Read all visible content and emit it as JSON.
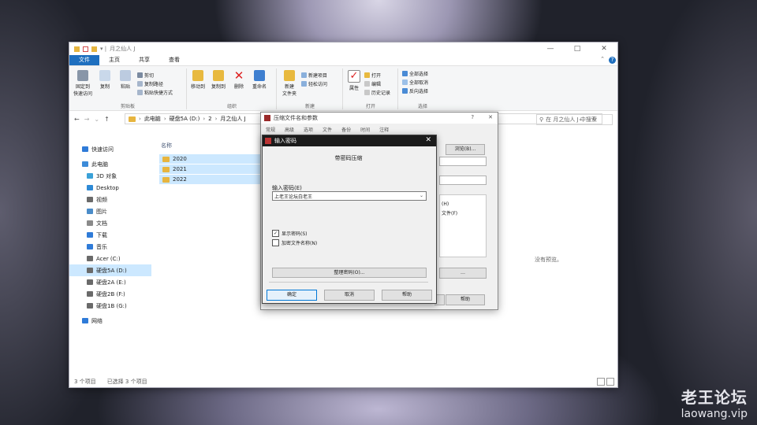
{
  "explorer": {
    "title": "月之仙人 J",
    "window_controls": [
      "—",
      "□",
      "✕"
    ],
    "tabs": [
      "文件",
      "主页",
      "共享",
      "查看"
    ],
    "ribbon": {
      "pin_label": "固定到\n快速访问",
      "copy_label": "复制",
      "paste_label": "粘贴",
      "cut_label": "剪切",
      "copy_path_label": "复制路径",
      "paste_shortcut_label": "粘贴快捷方式",
      "clipboard_group": "剪贴板",
      "move_to_label": "移动到",
      "copy_to_label": "复制到",
      "delete_label": "删除",
      "rename_label": "重命名",
      "organize_group": "组织",
      "new_folder_label": "新建\n文件夹",
      "new_item_label": "新建项目",
      "easy_access_label": "轻松访问",
      "new_group": "新建",
      "properties_label": "属性",
      "open_label": "打开",
      "edit_label": "编辑",
      "history_label": "历史记录",
      "open_group": "打开",
      "select_all_label": "全部选择",
      "select_none_label": "全部取消",
      "invert_selection_label": "反向选择",
      "select_group": "选择"
    },
    "address": {
      "crumbs": [
        "此电脑",
        "硬盘5A (D:)",
        "2",
        "月之仙人 J"
      ],
      "search_placeholder": "在 月之仙人 J 中搜索"
    },
    "nav": [
      {
        "label": "快速访问",
        "icon": "star-icon",
        "color": "#2f7bd8"
      },
      {
        "label": "此电脑",
        "icon": "computer-icon",
        "color": "#3c8bd9"
      },
      {
        "label": "3D 对象",
        "icon": "cube-icon",
        "color": "#3aa1d8"
      },
      {
        "label": "Desktop",
        "icon": "desktop-icon",
        "color": "#2e8ad6"
      },
      {
        "label": "视频",
        "icon": "video-icon",
        "color": "#6a6a6a"
      },
      {
        "label": "图片",
        "icon": "picture-icon",
        "color": "#4a8cc9"
      },
      {
        "label": "文档",
        "icon": "document-icon",
        "color": "#8a8a8a"
      },
      {
        "label": "下载",
        "icon": "download-icon",
        "color": "#2f7bd8"
      },
      {
        "label": "音乐",
        "icon": "music-icon",
        "color": "#2f7bd8"
      },
      {
        "label": "Acer (C:)",
        "icon": "drive-icon",
        "color": "#6a6a6a"
      },
      {
        "label": "硬盘5A (D:)",
        "icon": "drive-icon",
        "color": "#6a6a6a"
      },
      {
        "label": "硬盘2A (E:)",
        "icon": "drive-icon",
        "color": "#6a6a6a"
      },
      {
        "label": "硬盘2B (F:)",
        "icon": "drive-icon",
        "color": "#6a6a6a"
      },
      {
        "label": "硬盘1B (G:)",
        "icon": "drive-icon",
        "color": "#6a6a6a"
      },
      {
        "label": "网络",
        "icon": "network-icon",
        "color": "#2f7bd8"
      }
    ],
    "column_name": "名称",
    "files": [
      "2020",
      "2021",
      "2022"
    ],
    "empty_preview": "没有预览。",
    "status": {
      "count": "3 个项目",
      "selected": "已选择 3 个项目"
    }
  },
  "archive_dialog": {
    "title": "压缩文件名和参数",
    "help": "?",
    "close": "✕",
    "tabs": [
      "常规",
      "高级",
      "选项",
      "文件",
      "备份",
      "时间",
      "注释"
    ],
    "browse_label": "浏览(B)...",
    "list_fragment_1": "文件(F)",
    "list_fragment_2": "(H)",
    "ok_label": "确定",
    "help_label": "帮助"
  },
  "password_dialog": {
    "title": "输入密码",
    "close": "✕",
    "heading": "带密码压缩",
    "input_label": "输入密码(E)",
    "password_value": "上老王论坛白老王",
    "show_password_label": "显示密码(S)",
    "show_password_checked": "✓",
    "encrypt_names_label": "加密文件名称(N)",
    "organize_label": "整理密码(O)...",
    "ok_label": "确定",
    "cancel_label": "取消",
    "help_label": "帮助"
  },
  "watermark": {
    "cn": "老王论坛",
    "en": "laowang.vip"
  }
}
